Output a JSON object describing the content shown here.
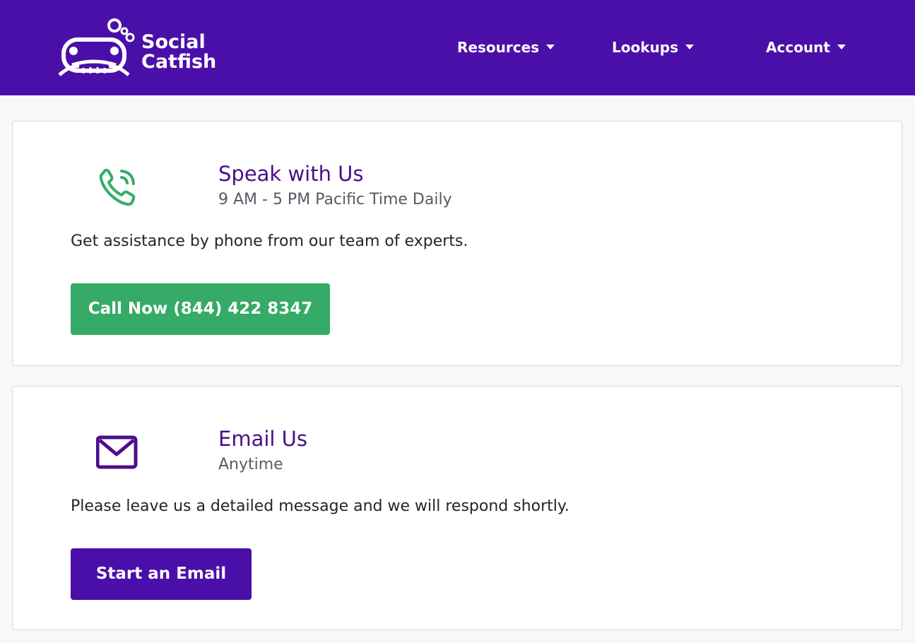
{
  "header": {
    "logo": {
      "line1": "Social",
      "line2": "Catfish",
      "icon": "catfish-logo-icon"
    },
    "nav": [
      {
        "label": "Resources",
        "icon": "caret-down-icon"
      },
      {
        "label": "Lookups",
        "icon": "caret-down-icon"
      },
      {
        "label": "Account",
        "icon": "caret-down-icon"
      }
    ]
  },
  "contact_options": {
    "phone": {
      "icon": "phone-icon",
      "title": "Speak with Us",
      "subtitle": "9 AM - 5 PM Pacific Time Daily",
      "description": "Get assistance by phone from our team of experts.",
      "button_label": "Call Now (844) 422 8347"
    },
    "email": {
      "icon": "envelope-icon",
      "title": "Email Us",
      "subtitle": "Anytime",
      "description": "Please leave us a detailed message and we will respond shortly.",
      "button_label": "Start an Email"
    }
  },
  "colors": {
    "header_bg": "#4a0fa8",
    "title_purple": "#4a0f8a",
    "call_green": "#35ab67",
    "phone_icon_green": "#35ab67",
    "email_icon_purple": "#4a0f8a",
    "email_button": "#4a0fa8"
  }
}
